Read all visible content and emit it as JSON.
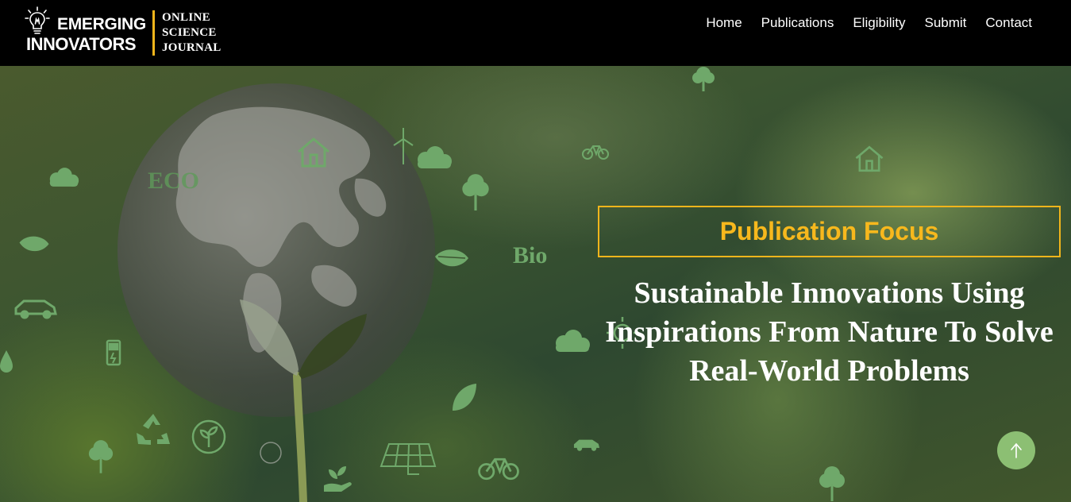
{
  "header": {
    "logo": {
      "line1": "EMERGING",
      "line2": "INNOVATORS",
      "journal_lines": [
        "ONLINE",
        "SCIENCE",
        "JOURNAL"
      ],
      "icon": "lightbulb-icon"
    },
    "nav": [
      {
        "label": "Home"
      },
      {
        "label": "Publications"
      },
      {
        "label": "Eligibility"
      },
      {
        "label": "Submit"
      },
      {
        "label": "Contact"
      }
    ]
  },
  "hero": {
    "focus_label": "Publication Focus",
    "title": "Sustainable Innovations Using Inspirations From Nature To Solve Real-World Problems",
    "image_badges": [
      "ECO",
      "Bio"
    ]
  },
  "scroll_top": {
    "icon": "arrow-up-icon"
  },
  "colors": {
    "accent": "#f2b51b",
    "header_bg": "#000000",
    "scroll_button": "#8cbf73",
    "icon_green": "#6fa86a"
  }
}
